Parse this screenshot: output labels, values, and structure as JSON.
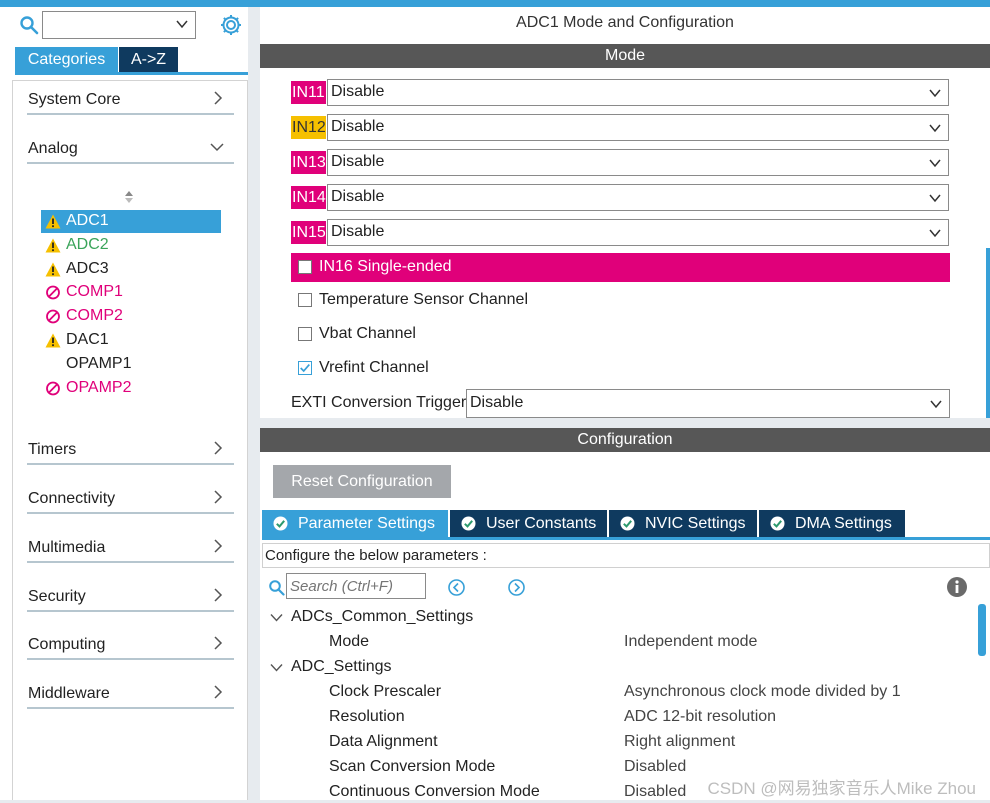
{
  "window_title": "ADC1 Mode and Configuration",
  "left": {
    "search": {
      "value": "",
      "placeholder": ""
    },
    "tabs": [
      "Categories",
      "A->Z"
    ],
    "categories_top": [
      {
        "label": "System Core",
        "state": "collapsed"
      },
      {
        "label": "Analog",
        "state": "expanded"
      }
    ],
    "analog_items": [
      {
        "label": "ADC1",
        "status": "warning",
        "selected": true,
        "color": "#ffffff"
      },
      {
        "label": "ADC2",
        "status": "warning",
        "selected": false,
        "color": "#3aa45a"
      },
      {
        "label": "ADC3",
        "status": "warning",
        "selected": false,
        "color": "#222222"
      },
      {
        "label": "COMP1",
        "status": "disabled",
        "selected": false,
        "color": "#e0007a"
      },
      {
        "label": "COMP2",
        "status": "disabled",
        "selected": false,
        "color": "#e0007a"
      },
      {
        "label": "DAC1",
        "status": "warning",
        "selected": false,
        "color": "#222222"
      },
      {
        "label": "OPAMP1",
        "status": "none",
        "selected": false,
        "color": "#222222"
      },
      {
        "label": "OPAMP2",
        "status": "disabled",
        "selected": false,
        "color": "#e0007a"
      }
    ],
    "categories_bottom": [
      {
        "label": "Timers"
      },
      {
        "label": "Connectivity"
      },
      {
        "label": "Multimedia"
      },
      {
        "label": "Security"
      },
      {
        "label": "Computing"
      },
      {
        "label": "Middleware"
      }
    ]
  },
  "mode": {
    "header": "Mode",
    "inputs": [
      {
        "name": "IN11",
        "value": "Disable",
        "badge": "pink"
      },
      {
        "name": "IN12",
        "value": "Disable",
        "badge": "yellow"
      },
      {
        "name": "IN13",
        "value": "Disable",
        "badge": "pink"
      },
      {
        "name": "IN14",
        "value": "Disable",
        "badge": "pink"
      },
      {
        "name": "IN15",
        "value": "Disable",
        "badge": "pink"
      }
    ],
    "checkboxes": [
      {
        "label": "IN16 Single-ended",
        "checked": false,
        "highlight": true
      },
      {
        "label": "Temperature Sensor Channel",
        "checked": false,
        "highlight": false
      },
      {
        "label": "Vbat Channel",
        "checked": false,
        "highlight": false
      },
      {
        "label": "Vrefint Channel",
        "checked": true,
        "highlight": false
      }
    ],
    "exti": {
      "label": "EXTI Conversion Trigger",
      "value": "Disable"
    }
  },
  "configuration": {
    "header": "Configuration",
    "reset_label": "Reset Configuration",
    "tabs": [
      {
        "label": "Parameter Settings",
        "active": true
      },
      {
        "label": "User Constants",
        "active": false
      },
      {
        "label": "NVIC Settings",
        "active": false
      },
      {
        "label": "DMA Settings",
        "active": false
      }
    ],
    "hint": "Configure the below parameters :",
    "search_placeholder": "Search (Ctrl+F)",
    "groups": [
      {
        "name": "ADCs_Common_Settings",
        "params": [
          {
            "name": "Mode",
            "value": "Independent mode"
          }
        ]
      },
      {
        "name": "ADC_Settings",
        "params": [
          {
            "name": "Clock Prescaler",
            "value": "Asynchronous clock mode divided by 1"
          },
          {
            "name": "Resolution",
            "value": "ADC 12-bit resolution"
          },
          {
            "name": "Data Alignment",
            "value": "Right alignment"
          },
          {
            "name": "Scan Conversion Mode",
            "value": "Disabled"
          },
          {
            "name": "Continuous Conversion Mode",
            "value": "Disabled"
          }
        ]
      }
    ]
  },
  "colors": {
    "accent": "#37a0d8",
    "dark_tab": "#0f3a5f",
    "pink": "#e0007a",
    "yellow": "#f6c000",
    "band": "#575757"
  },
  "watermark": "CSDN @网易独家音乐人Mike Zhou"
}
